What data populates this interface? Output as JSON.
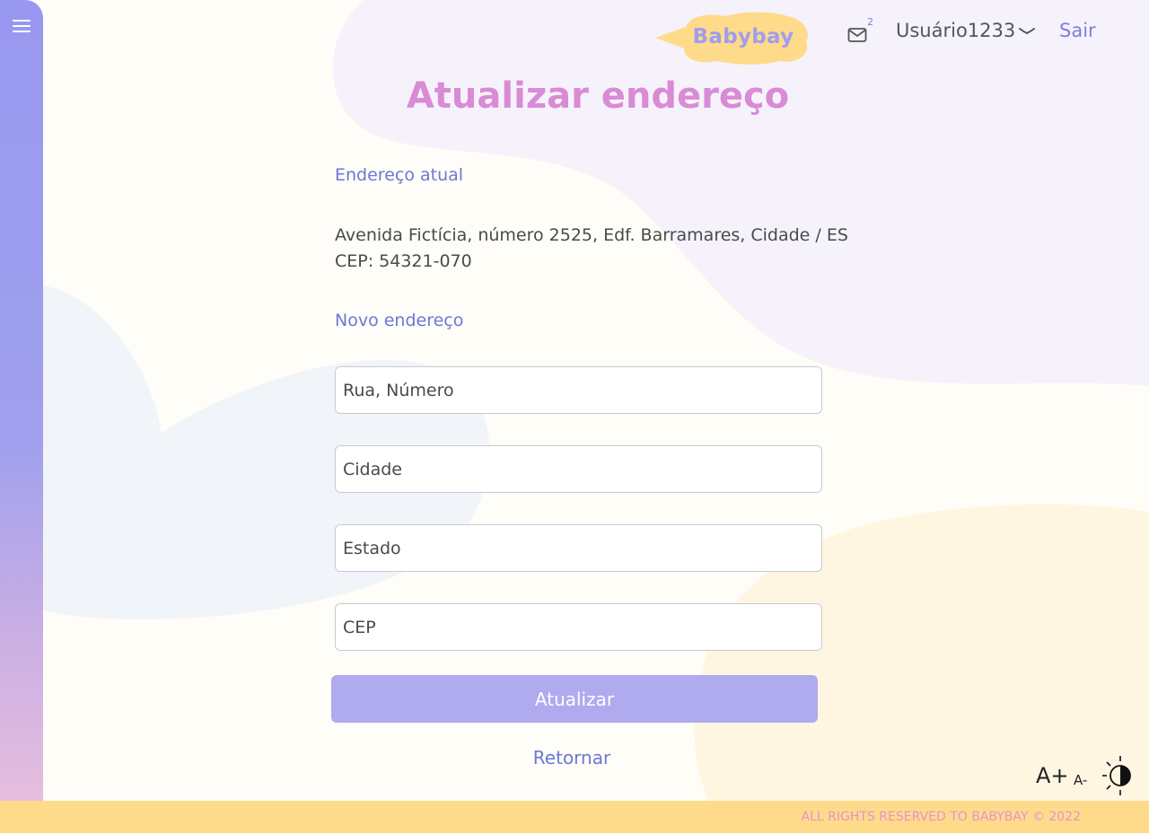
{
  "header": {
    "logo_text": "Babybay",
    "mail_count": "2",
    "username": "Usuário1233",
    "logout_label": "Sair"
  },
  "page": {
    "title": "Atualizar endereço"
  },
  "current_address": {
    "label": "Endereço atual",
    "line1": "Avenida Fictícia, número 2525, Edf. Barramares, Cidade / ES",
    "line2": "CEP: 54321-070"
  },
  "new_address": {
    "label": "Novo endereço",
    "fields": {
      "street_placeholder": "Rua, Número",
      "city_placeholder": "Cidade",
      "state_placeholder": "Estado",
      "zip_placeholder": "CEP"
    }
  },
  "actions": {
    "submit_label": "Atualizar",
    "back_label": "Retornar"
  },
  "accessibility": {
    "increase_font_label": "A+",
    "decrease_font_label": "A-"
  },
  "footer": {
    "copyright": "ALL RIGHTS RESERVED TO BABYBAY © 2022"
  },
  "colors": {
    "sidebar": "#9898f0",
    "accent_blue": "#6b78d8",
    "title_pink": "#d98bd6",
    "button": "#b0aaee",
    "logo_bubble": "#fedb8a",
    "footer": "#fedb8a"
  },
  "icons": {
    "menu": "hamburger-icon",
    "mail": "envelope-icon",
    "user_menu": "chevron-down-icon",
    "contrast": "contrast-icon"
  }
}
